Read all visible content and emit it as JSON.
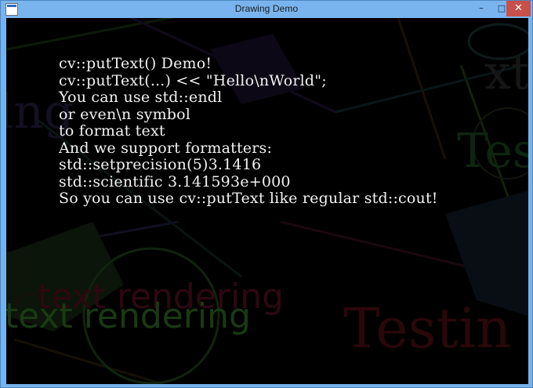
{
  "window": {
    "title": "Drawing Demo",
    "icon": "app-window-icon",
    "controls": {
      "minimize": "–",
      "maximize": "□",
      "close": "✕"
    },
    "frame_color": "#76b2ec",
    "close_color": "#c7504a"
  },
  "canvas": {
    "background": "#000000",
    "text_color": "#f2f2f2",
    "lines": [
      "cv::putText() Demo!",
      "cv::putText(...) << \"Hello\\nWorld\";",
      "You can use std::endl",
      "or even\\n symbol",
      "to format text",
      "And we support formatters:",
      "std::setprecision(5)3.1416",
      "std::scientific 3.141593e+000",
      "So you can use cv::putText like regular std::cout!"
    ]
  }
}
